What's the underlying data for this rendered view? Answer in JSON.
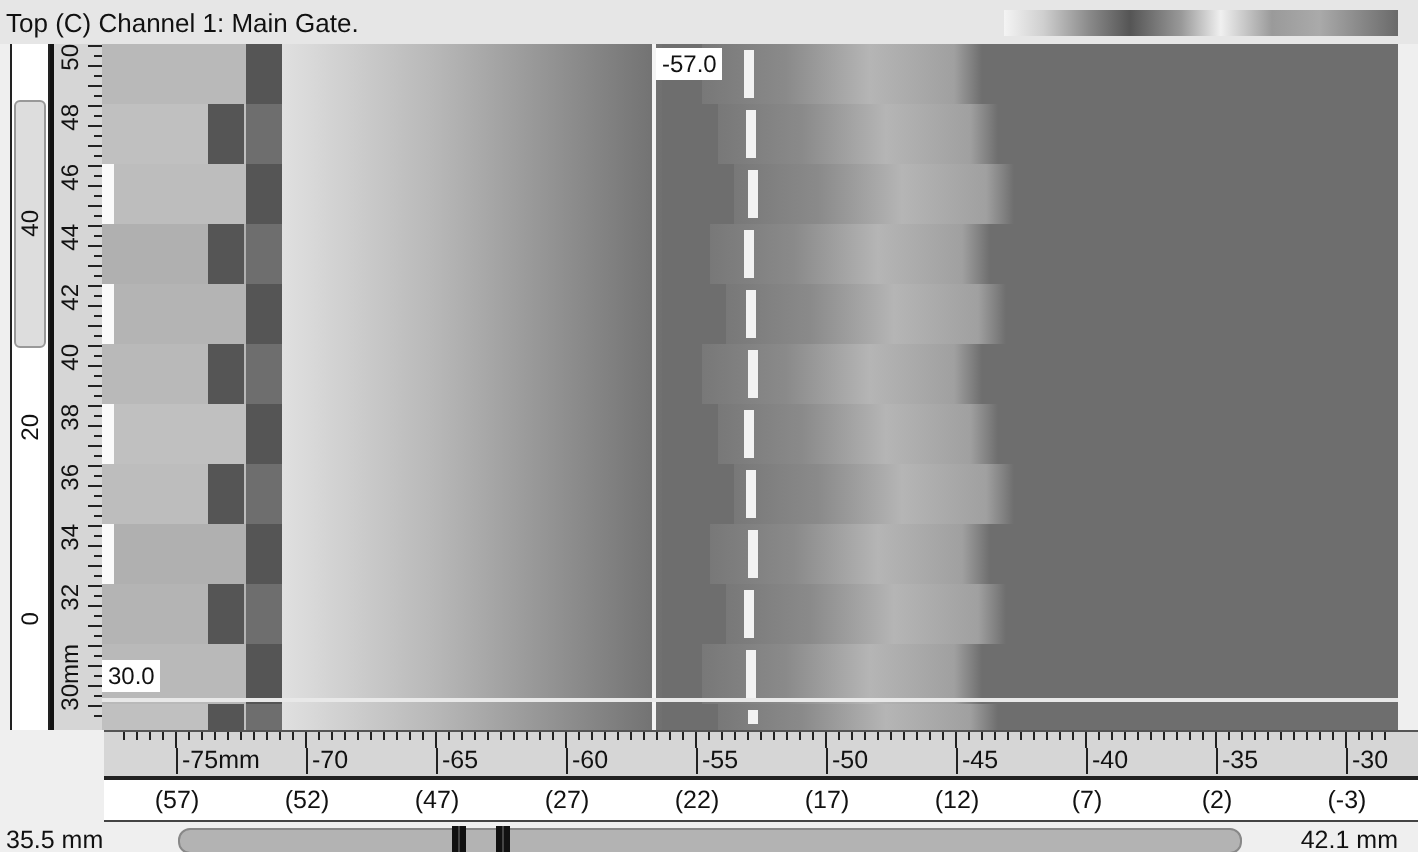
{
  "window": {
    "title": "Top (C) Channel 1: Main Gate."
  },
  "left_scale": {
    "thumb_label": "40",
    "labels": [
      "20",
      "0"
    ]
  },
  "vertical_ruler": {
    "labels": [
      "50",
      "48",
      "46",
      "44",
      "42",
      "40",
      "38",
      "36",
      "34",
      "32",
      "30mm"
    ]
  },
  "scan": {
    "cursor_x_reading": "-57.0",
    "cursor_y_reading": "30.0"
  },
  "horizontal_ruler": {
    "labels": [
      "-75mm",
      "-70",
      "-65",
      "-60",
      "-55",
      "-50",
      "-45",
      "-40",
      "-35",
      "-30"
    ]
  },
  "index_row": {
    "labels": [
      "(57)",
      "(52)",
      "(47)",
      "(27)",
      "(22)",
      "(17)",
      "(12)",
      "(7)",
      "(2)",
      "(-3)"
    ]
  },
  "scan_range": {
    "start": "35.5 mm",
    "end": "42.1 mm"
  }
}
